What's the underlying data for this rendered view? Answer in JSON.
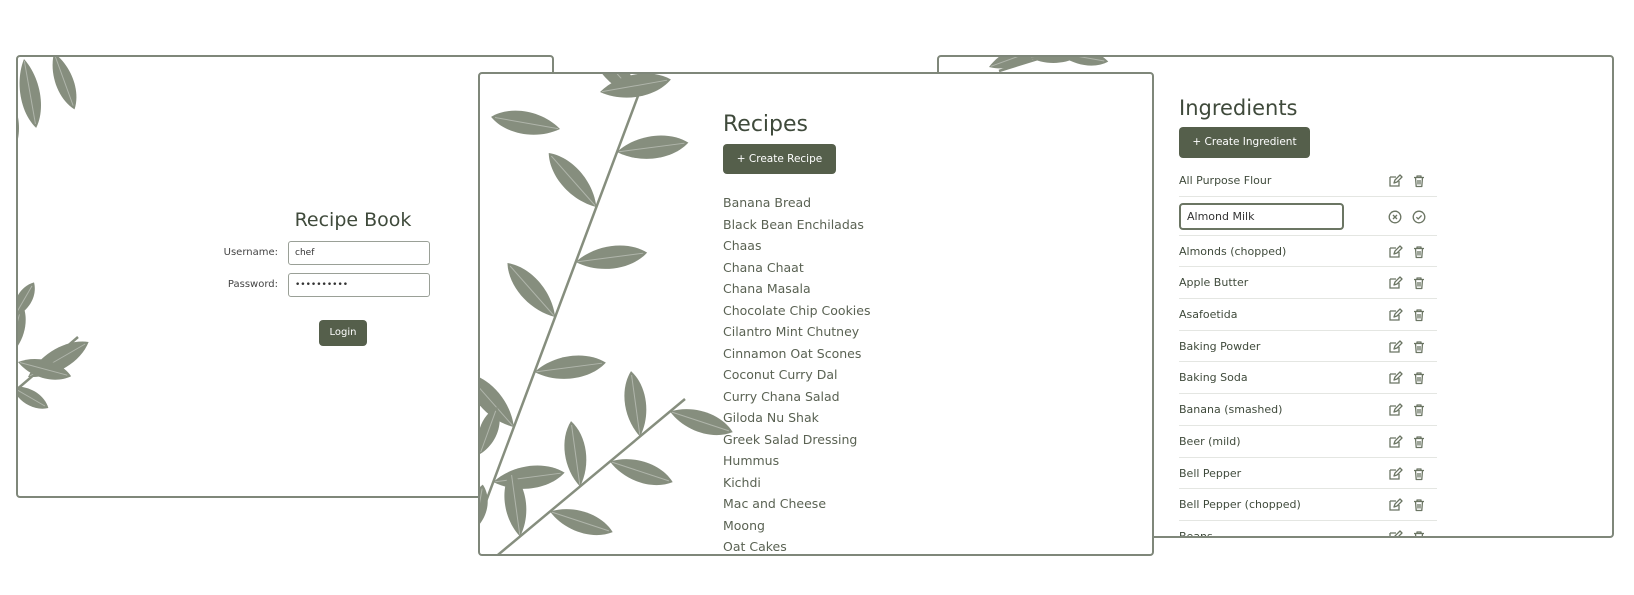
{
  "login": {
    "title": "Recipe Book",
    "username_label": "Username:",
    "username_value": "chef",
    "password_label": "Password:",
    "password_value": "••••••••••",
    "login_label": "Login"
  },
  "recipes": {
    "title": "Recipes",
    "create_label": "+ Create Recipe",
    "items": [
      "Banana Bread",
      "Black Bean Enchiladas",
      "Chaas",
      "Chana Chaat",
      "Chana Masala",
      "Chocolate Chip Cookies",
      "Cilantro Mint Chutney",
      "Cinnamon Oat Scones",
      "Coconut Curry Dal",
      "Curry Chana Salad",
      "Giloda Nu Shak",
      "Greek Salad Dressing",
      "Hummus",
      "Kichdi",
      "Mac and Cheese",
      "Moong",
      "Oat Cakes"
    ]
  },
  "ingredients": {
    "title": "Ingredients",
    "create_label": "+ Create Ingredient",
    "items": [
      {
        "name": "All Purpose Flour",
        "editing": false
      },
      {
        "name": "Almond Milk",
        "editing": true
      },
      {
        "name": "Almonds (chopped)",
        "editing": false
      },
      {
        "name": "Apple Butter",
        "editing": false
      },
      {
        "name": "Asafoetida",
        "editing": false
      },
      {
        "name": "Baking Powder",
        "editing": false
      },
      {
        "name": "Baking Soda",
        "editing": false
      },
      {
        "name": "Banana (smashed)",
        "editing": false
      },
      {
        "name": "Beer (mild)",
        "editing": false
      },
      {
        "name": "Bell Pepper",
        "editing": false
      },
      {
        "name": "Bell Pepper (chopped)",
        "editing": false
      },
      {
        "name": "Beans",
        "editing": false
      }
    ]
  },
  "theme": {
    "accent": "#555f4b",
    "leaf": "#868e7e",
    "border": "#7f877a",
    "text": "#3f4a3b"
  },
  "icons": {
    "edit": "pencil-square-icon",
    "delete": "trash-icon",
    "cancel": "circle-x-icon",
    "confirm": "circle-check-icon"
  }
}
